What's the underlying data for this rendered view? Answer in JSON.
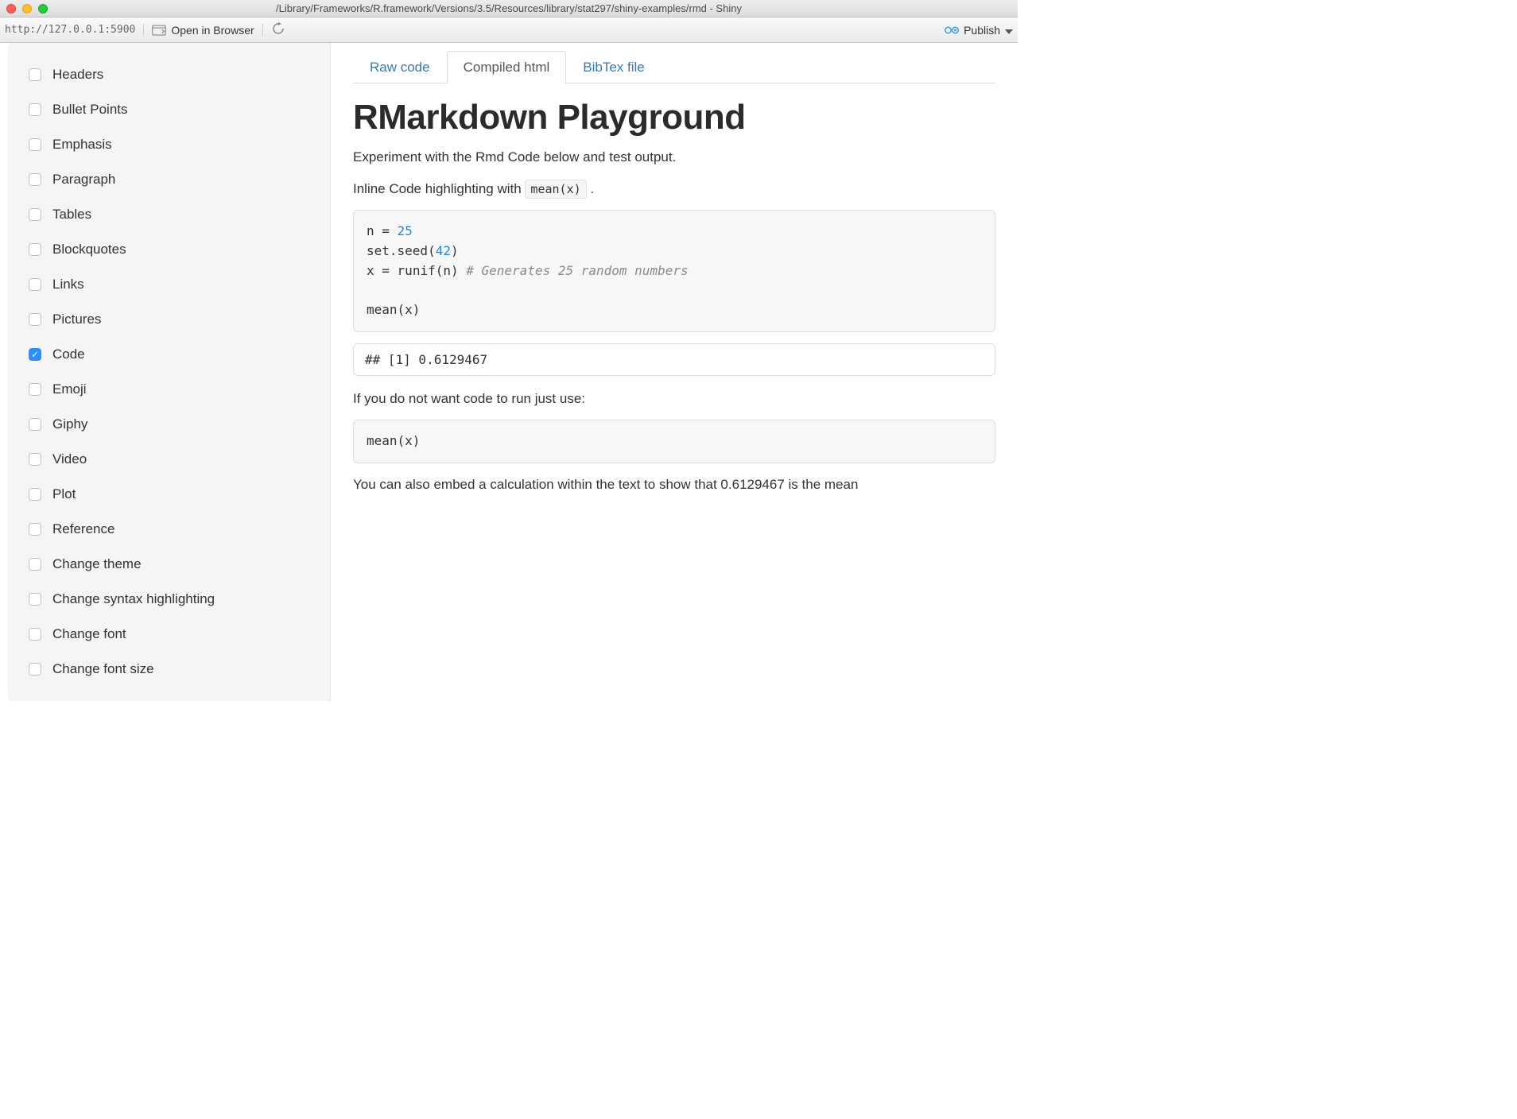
{
  "window": {
    "title": "/Library/Frameworks/R.framework/Versions/3.5/Resources/library/stat297/shiny-examples/rmd - Shiny"
  },
  "toolbar": {
    "url": "http://127.0.0.1:5900",
    "open_in_browser": "Open in Browser",
    "publish": "Publish"
  },
  "sidebar": {
    "items": [
      {
        "label": "Headers",
        "checked": false
      },
      {
        "label": "Bullet Points",
        "checked": false
      },
      {
        "label": "Emphasis",
        "checked": false
      },
      {
        "label": "Paragraph",
        "checked": false
      },
      {
        "label": "Tables",
        "checked": false
      },
      {
        "label": "Blockquotes",
        "checked": false
      },
      {
        "label": "Links",
        "checked": false
      },
      {
        "label": "Pictures",
        "checked": false
      },
      {
        "label": "Code",
        "checked": true
      },
      {
        "label": "Emoji",
        "checked": false
      },
      {
        "label": "Giphy",
        "checked": false
      },
      {
        "label": "Video",
        "checked": false
      },
      {
        "label": "Plot",
        "checked": false
      },
      {
        "label": "Reference",
        "checked": false
      },
      {
        "label": "Change theme",
        "checked": false
      },
      {
        "label": "Change syntax highlighting",
        "checked": false
      },
      {
        "label": "Change font",
        "checked": false
      },
      {
        "label": "Change font size",
        "checked": false
      }
    ]
  },
  "tabs": {
    "raw": "Raw code",
    "compiled": "Compiled html",
    "bibtex": "BibTex file",
    "active": "compiled"
  },
  "content": {
    "heading": "RMarkdown Playground",
    "intro": "Experiment with the Rmd Code below and test output.",
    "inline_prefix": "Inline Code highlighting with ",
    "inline_code": "mean(x)",
    "inline_suffix": " .",
    "code_n": "25",
    "code_seed": "42",
    "code_comment": "# Generates 25 random numbers",
    "output": "## [1] 0.6129467",
    "no_run": "If you do not want code to run just use:",
    "code_norun": "mean(x)",
    "embed_calc": "You can also embed a calculation within the text to show that 0.6129467 is the mean"
  }
}
